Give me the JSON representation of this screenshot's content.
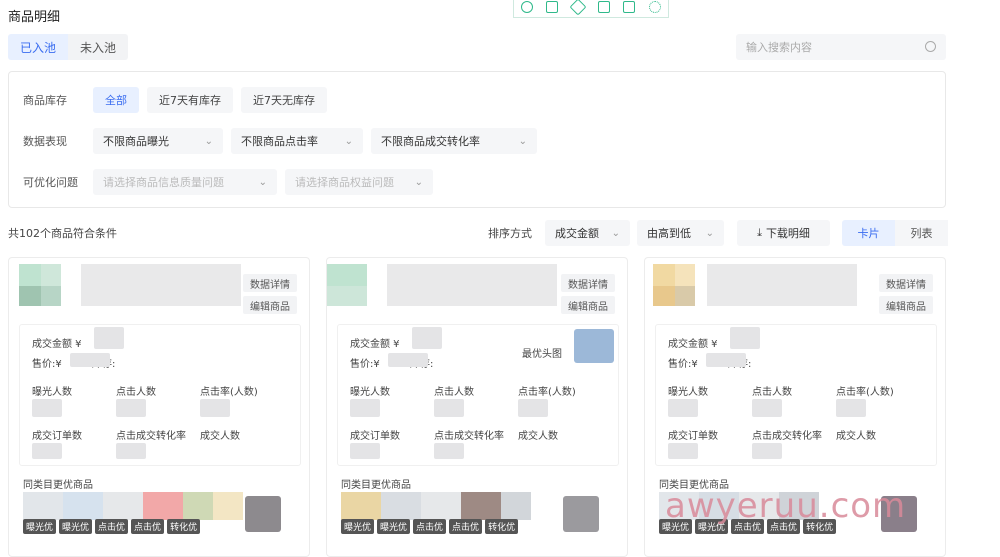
{
  "page": {
    "title": "商品明细"
  },
  "toolbar": {
    "icons": [
      "refresh-icon",
      "copy-icon",
      "expand-icon",
      "save-icon",
      "share-icon",
      "gear-icon"
    ]
  },
  "tabs": [
    {
      "label": "已入池",
      "active": true
    },
    {
      "label": "未入池",
      "active": false
    }
  ],
  "search": {
    "placeholder": "输入搜索内容"
  },
  "filters": {
    "stock": {
      "label": "商品库存",
      "options": [
        "全部",
        "近7天有库存",
        "近7天无库存"
      ],
      "active": "全部"
    },
    "performance": {
      "label": "数据表现",
      "selects": [
        "不限商品曝光",
        "不限商品点击率",
        "不限商品成交转化率"
      ]
    },
    "issues": {
      "label": "可优化问题",
      "placeholders": [
        "请选择商品信息质量问题",
        "请选择商品权益问题"
      ]
    }
  },
  "results": {
    "count_text": "共102个商品符合条件",
    "sort_label": "排序方式",
    "sort_field": "成交金额",
    "sort_order": "由高到低",
    "download_label": "下载明细",
    "views": [
      {
        "label": "卡片",
        "active": true
      },
      {
        "label": "列表",
        "active": false
      }
    ]
  },
  "card": {
    "data_detail": "数据详情",
    "edit_product": "编辑商品",
    "gmv_label": "成交金额 ¥",
    "price_label": "售价:¥",
    "stock_label": "库存:",
    "best_image": "最优头图",
    "metrics_row1": [
      "曝光人数",
      "点击人数",
      "点击率(人数)"
    ],
    "metrics_row2": [
      "成交订单数",
      "点击成交转化率",
      "成交人数"
    ],
    "similar_label": "同类目更优商品",
    "tags": [
      "曝光优",
      "曝光优",
      "点击优",
      "点击优",
      "转化优"
    ]
  },
  "watermark": "awyeruu.com",
  "colors": {
    "accent": "#3a6df0",
    "toolbar_green": "#2fb98a",
    "watermark": "#d98a9a"
  }
}
